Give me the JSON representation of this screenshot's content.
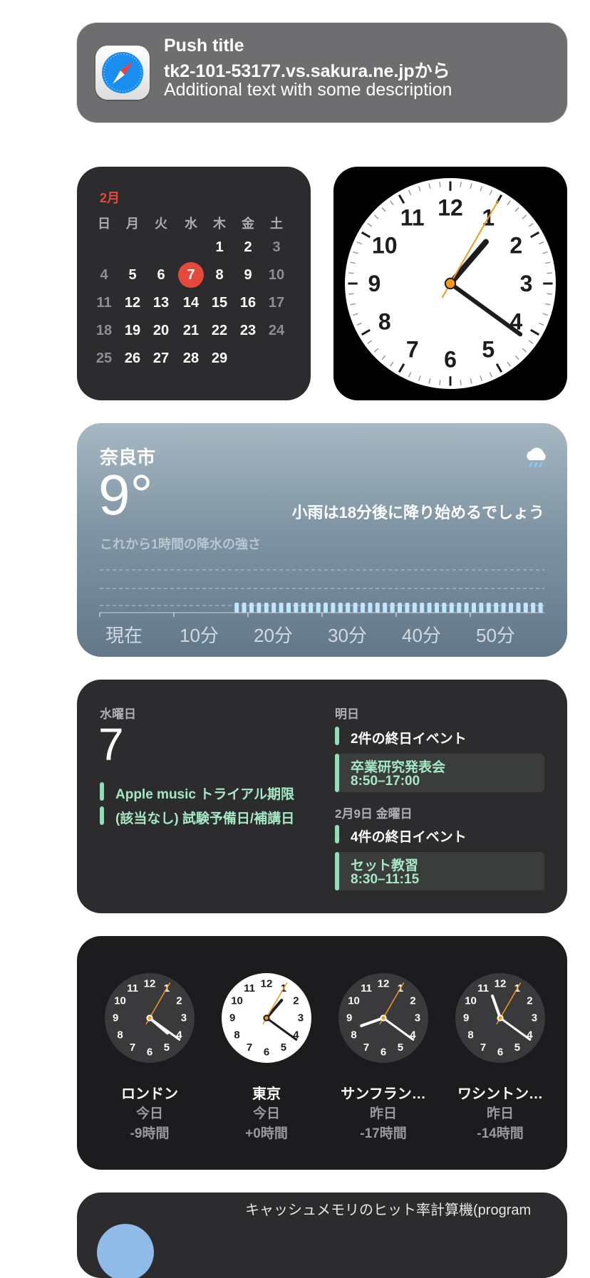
{
  "notification": {
    "title": "Push title",
    "source": "tk2-101-53177.vs.sakura.ne.jpから",
    "body": "Additional text with some description",
    "app_icon": "safari-compass-icon"
  },
  "calendar": {
    "month": "2月",
    "weekdays": [
      "日",
      "月",
      "火",
      "水",
      "木",
      "金",
      "土"
    ],
    "weeks": [
      [
        "",
        "",
        "",
        "",
        "1",
        "2",
        "3"
      ],
      [
        "4",
        "5",
        "6",
        "7",
        "8",
        "9",
        "10"
      ],
      [
        "11",
        "12",
        "13",
        "14",
        "15",
        "16",
        "17"
      ],
      [
        "18",
        "19",
        "20",
        "21",
        "22",
        "23",
        "24"
      ],
      [
        "25",
        "26",
        "27",
        "28",
        "29",
        "",
        ""
      ]
    ],
    "today": "7",
    "today_color": "#e5493a",
    "month_color": "#e5493a"
  },
  "analog_clock": {
    "numerals": [
      "12",
      "1",
      "2",
      "3",
      "4",
      "5",
      "6",
      "7",
      "8",
      "9",
      "10",
      "11"
    ],
    "hour": 1,
    "minute": 21,
    "second": 5,
    "second_hand_color": "#f19a1d"
  },
  "weather": {
    "city": "奈良市",
    "temperature": "9°",
    "condition_icon": "cloud-rain-icon",
    "forecast": "小雨は18分後に降り始めるでしょう",
    "chart_title": "これから1時間の降水の強さ",
    "time_labels": [
      "現在",
      "10分",
      "20分",
      "30分",
      "40分",
      "50分"
    ],
    "rain_start_minute": 18
  },
  "events": {
    "weekday": "水曜日",
    "day": "7",
    "today_items": [
      "Apple music トライアル期限",
      "(該当なし) 試験予備日/補講日"
    ],
    "tomorrow_label": "明日",
    "tomorrow_allday": "2件の終日イベント",
    "tomorrow_event": {
      "title": "卒業研究発表会",
      "time": "8:50–17:00"
    },
    "later_label": "2月9日 金曜日",
    "later_allday": "4件の終日イベント",
    "later_event": {
      "title": "セット教習",
      "time": "8:30–11:15"
    },
    "accent_color": "#8fe0b8"
  },
  "world_clock": {
    "cities": [
      {
        "name": "ロンドン",
        "day": "今日",
        "offset": "-9時間",
        "face": "dark",
        "hour": 4,
        "minute": 21
      },
      {
        "name": "東京",
        "day": "今日",
        "offset": "+0時間",
        "face": "light",
        "hour": 1,
        "minute": 21
      },
      {
        "name": "サンフラン…",
        "day": "昨日",
        "offset": "-17時間",
        "face": "dark",
        "hour": 8,
        "minute": 21
      },
      {
        "name": "ワシントン…",
        "day": "昨日",
        "offset": "-14時間",
        "face": "dark",
        "hour": 11,
        "minute": 21
      }
    ]
  },
  "partial_widget": {
    "text": "キャッシュメモリのヒット率計算機(program"
  }
}
